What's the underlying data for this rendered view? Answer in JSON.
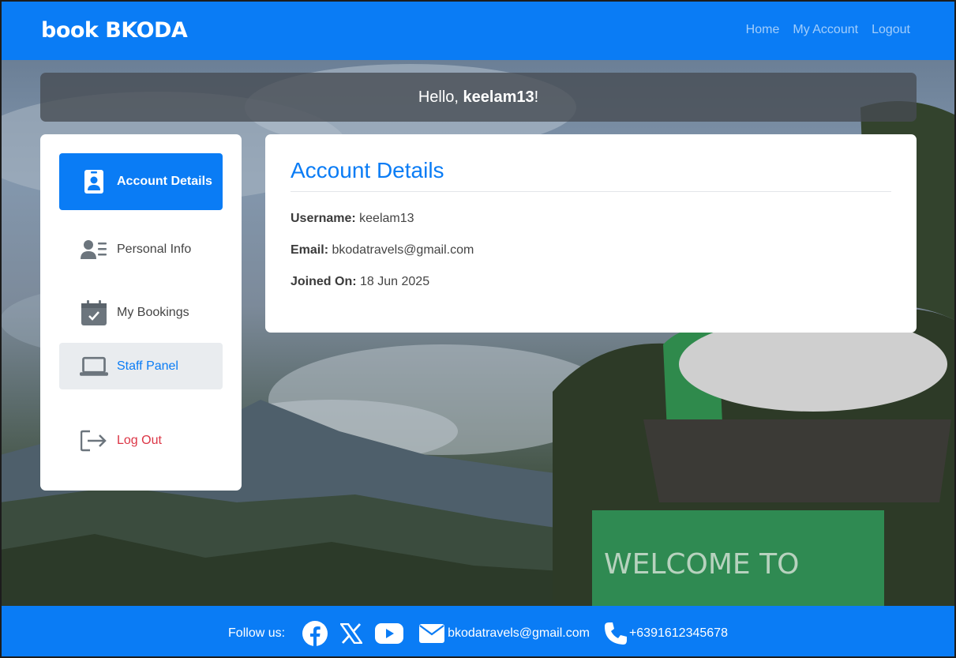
{
  "header": {
    "brand": "book BKODA",
    "nav": [
      "Home",
      "My Account",
      "Logout"
    ]
  },
  "greeting": {
    "prefix": "Hello, ",
    "username": "keelam13",
    "suffix": "!"
  },
  "sidebar": {
    "items": [
      {
        "label": "Account Details",
        "icon": "id-badge-icon"
      },
      {
        "label": "Personal Info",
        "icon": "user-list-icon"
      },
      {
        "label": "My Bookings",
        "icon": "calendar-check-icon"
      },
      {
        "label": "Staff Panel",
        "icon": "laptop-icon"
      },
      {
        "label": "Log Out",
        "icon": "sign-out-icon"
      }
    ]
  },
  "account": {
    "title": "Account Details",
    "fields": [
      {
        "key": "Username:",
        "value": "keelam13"
      },
      {
        "key": "Email:",
        "value": "bkodatravels@gmail.com"
      },
      {
        "key": "Joined On:",
        "value": "18 Jun 2025"
      }
    ]
  },
  "footer": {
    "follow": "Follow us:",
    "email": "bkodatravels@gmail.com",
    "phone": "+6391612345678"
  },
  "colors": {
    "primary": "#0a7cf5",
    "danger": "#dc3545",
    "muted_bg": "#e9ecef"
  }
}
